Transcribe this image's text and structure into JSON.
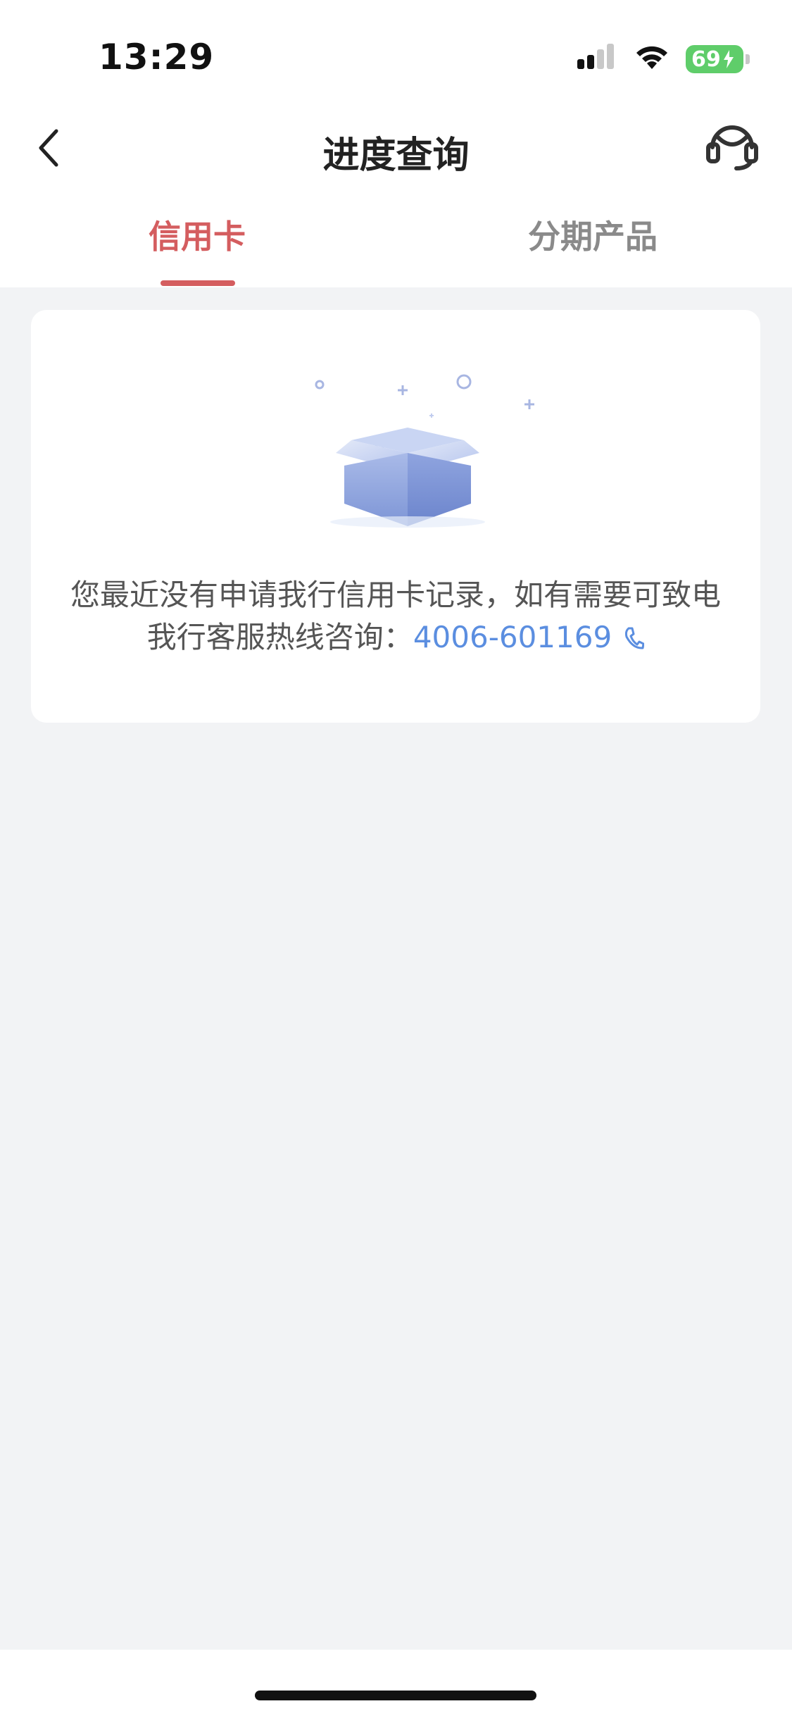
{
  "status_bar": {
    "time": "13:29",
    "battery": "69",
    "icons": [
      "signal-icon",
      "wifi-icon",
      "battery-icon"
    ]
  },
  "nav": {
    "title": "进度查询",
    "back_icon": "chevron-left-icon",
    "support_icon": "headset-icon"
  },
  "tabs": [
    {
      "label": "信用卡",
      "active": true
    },
    {
      "label": "分期产品",
      "active": false
    }
  ],
  "empty_state": {
    "message_line1": "您最近没有申请我行信用卡记录，如有需要可致电",
    "message_line2_prefix": "我行客服热线咨询：",
    "hotline": "4006-601169",
    "phone_icon": "phone-icon",
    "illustration": "empty-box-icon"
  },
  "colors": {
    "accent_red": "#d45d5f",
    "link_blue": "#5b8ee0",
    "background": "#f2f3f5",
    "battery_green": "#5fcd6a"
  }
}
